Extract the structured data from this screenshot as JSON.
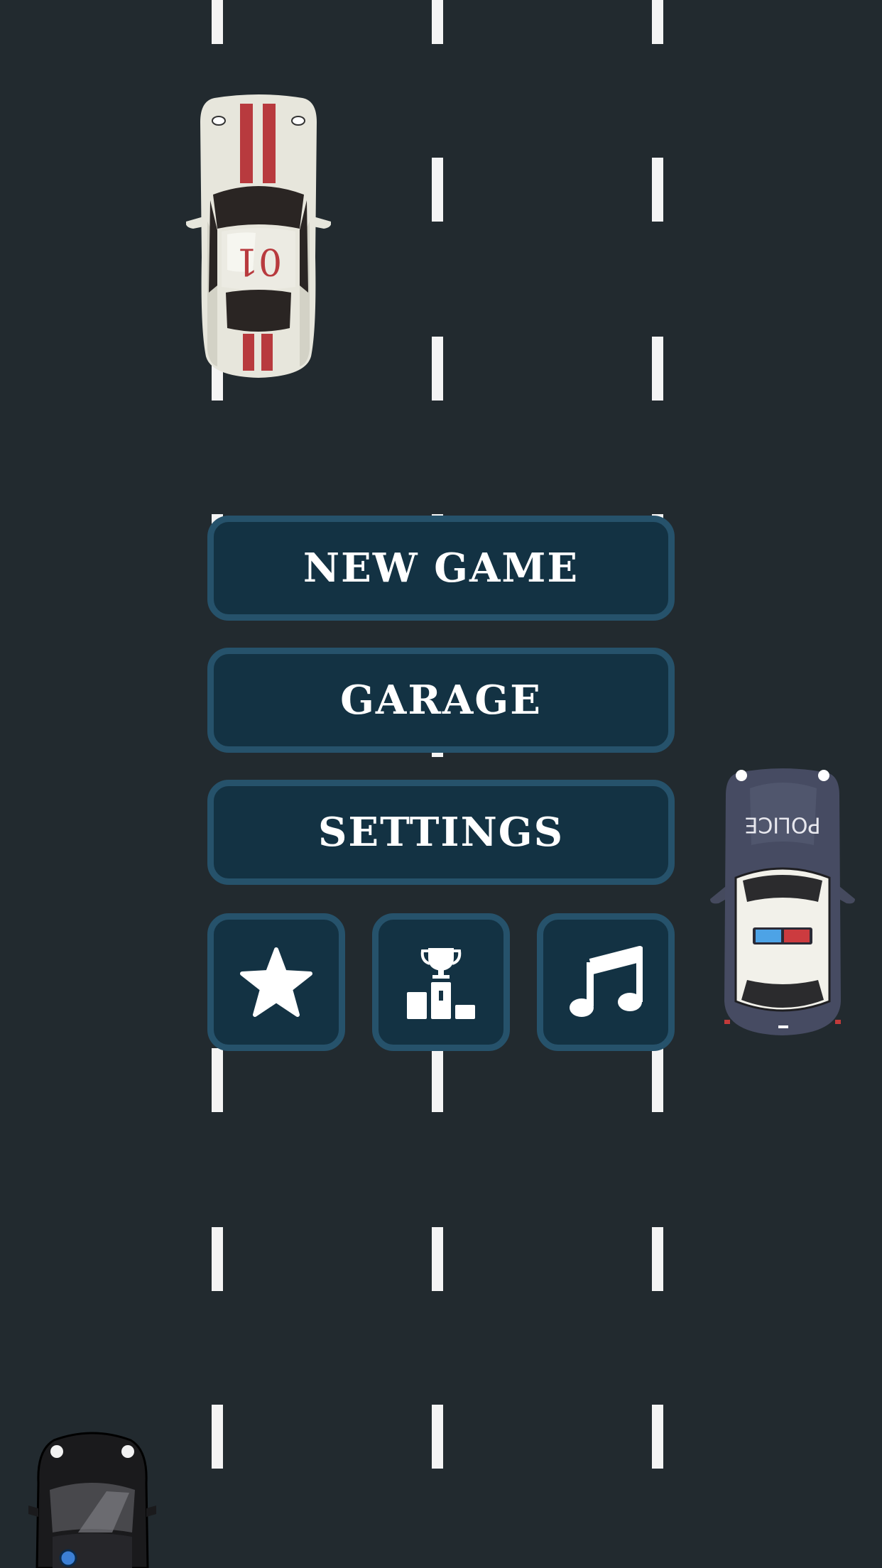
{
  "menu": {
    "new_game_label": "NEW GAME",
    "garage_label": "GARAGE",
    "settings_label": "SETTINGS"
  },
  "icons": [
    "star-icon",
    "podium-trophy-icon",
    "music-note-icon"
  ],
  "cars": {
    "race_car_number": "01",
    "police_label": "POLICE"
  },
  "colors": {
    "road": "#222a2f",
    "button_fill": "#133243",
    "button_border": "#26526b",
    "lane_marking": "#f4f4f4"
  }
}
